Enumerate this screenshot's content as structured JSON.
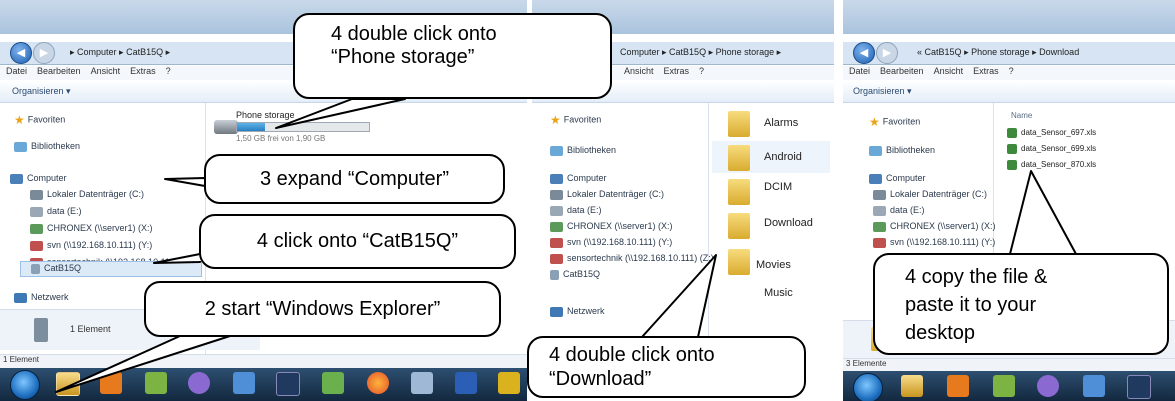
{
  "panel1": {
    "breadcrumb": [
      "Computer",
      "CatB15Q"
    ],
    "menu": [
      "Datei",
      "Bearbeiten",
      "Ansicht",
      "Extras",
      "?"
    ],
    "organize": "Organisieren ▾",
    "nav": {
      "favorites": "Favoriten",
      "libraries": "Bibliotheken",
      "computer": "Computer",
      "drives": [
        "Lokaler Datenträger (C:)",
        "data (E:)",
        "CHRONEX (\\\\server1) (X:)",
        "svn (\\\\192.168.10.111) (Y:)",
        "sensortechnik (\\\\192.168.10.111) (Z:)",
        "CatB15Q"
      ],
      "network": "Netzwerk"
    },
    "storage": {
      "name": "Phone storage",
      "free": "1,50 GB frei von 1,90 GB",
      "used_fraction": 0.21
    },
    "details": "1 Element",
    "status": "1 Element"
  },
  "panel2": {
    "breadcrumb": [
      "Computer",
      "CatB15Q",
      "Phone storage"
    ],
    "menu": [
      "Ansicht",
      "Extras",
      "?"
    ],
    "nav": {
      "favorites": "Favoriten",
      "libraries": "Bibliotheken",
      "computer": "Computer",
      "drives": [
        "Lokaler Datenträger (C:)",
        "data (E:)",
        "CHRONEX (\\\\server1) (X:)",
        "svn (\\\\192.168.10.111) (Y:)",
        "sensortechnik (\\\\192.168.10.111) (Z:)",
        "CatB15Q"
      ],
      "network": "Netzwerk"
    },
    "folders": [
      "Alarms",
      "Android",
      "DCIM",
      "Download",
      "Movies",
      "Music"
    ]
  },
  "panel3": {
    "breadcrumb": [
      "«",
      "CatB15Q",
      "Phone storage",
      "Download"
    ],
    "menu": [
      "Datei",
      "Bearbeiten",
      "Ansicht",
      "Extras",
      "?"
    ],
    "organize": "Organisieren ▾",
    "nav": {
      "favorites": "Favoriten",
      "libraries": "Bibliotheken",
      "computer": "Computer",
      "drives": [
        "Lokaler Datenträger (C:)",
        "data (E:)",
        "CHRONEX (\\\\server1) (X:)",
        "svn (\\\\192.168.10.111) (Y:)"
      ]
    },
    "column_header": "Name",
    "files": [
      "data_Sensor_697.xls",
      "data_Sensor_699.xls",
      "data_Sensor_870.xls"
    ],
    "status": "3 Elemente"
  },
  "callouts": {
    "c1": [
      "4 double click onto",
      "“Phone storage”"
    ],
    "c2": "3 expand “Computer”",
    "c3": "4 click onto “CatB15Q”",
    "c4": "2 start “Windows Explorer”",
    "c5": [
      "4 double click onto",
      "“Download”"
    ],
    "c6": [
      "4 copy the file &",
      "paste it to your",
      "desktop"
    ]
  },
  "colors": {
    "accent": "#1d5fb3",
    "callout_border": "#000000",
    "taskbar": "#1b344f"
  }
}
